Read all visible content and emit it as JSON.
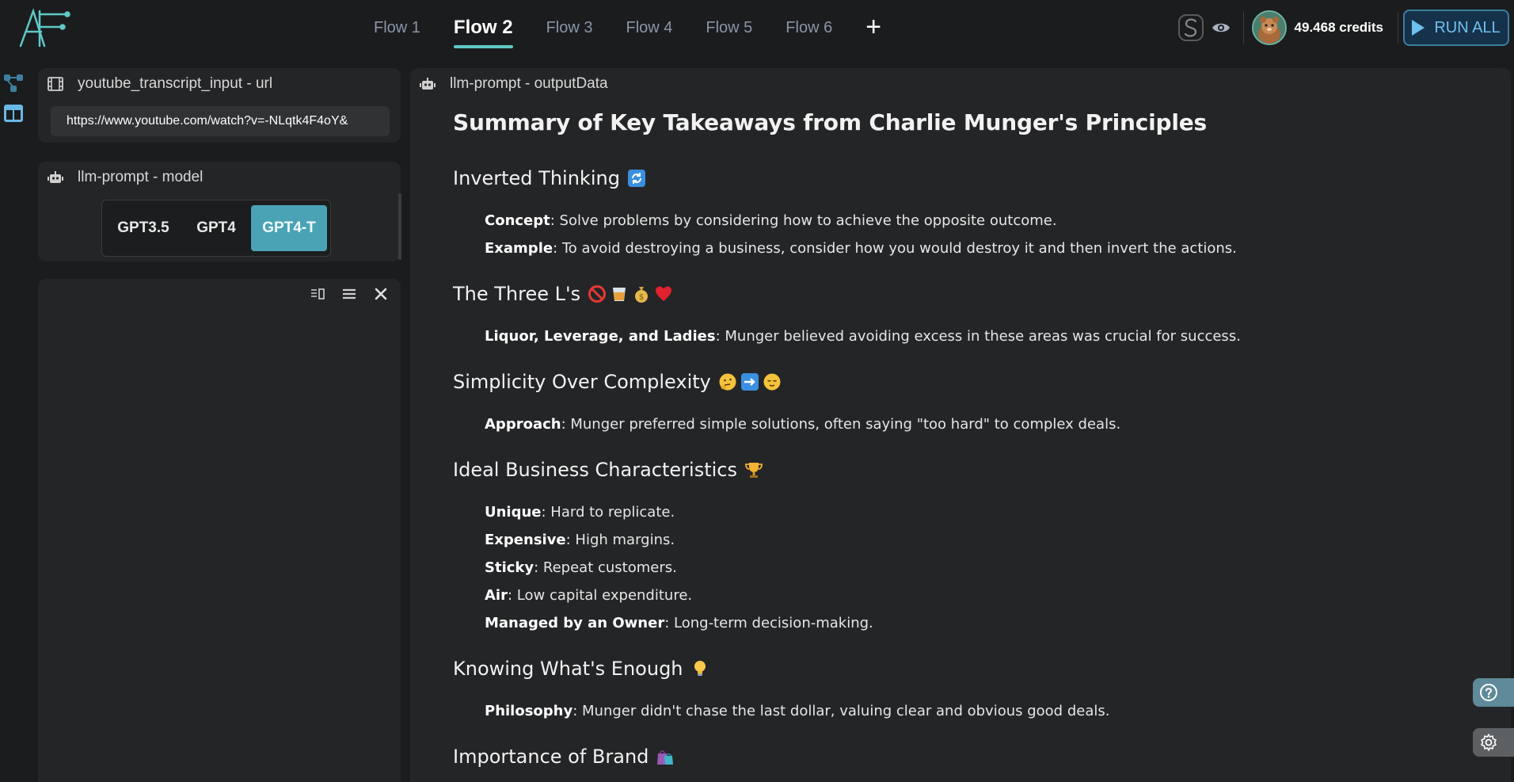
{
  "header": {
    "logo_text": "AF",
    "tabs": [
      {
        "label": "Flow 1",
        "active": false
      },
      {
        "label": "Flow 2",
        "active": true
      },
      {
        "label": "Flow 3",
        "active": false
      },
      {
        "label": "Flow 4",
        "active": false
      },
      {
        "label": "Flow 5",
        "active": false
      },
      {
        "label": "Flow 6",
        "active": false
      }
    ],
    "add_tab_label": "+",
    "s_badge": "S",
    "credits": "49.468 credits",
    "run_all_label": "RUN ALL"
  },
  "rail": {
    "icons": [
      "flow-graph-icon",
      "layout-panels-icon"
    ]
  },
  "url_panel": {
    "title": "youtube_transcript_input - url",
    "icon": "film-icon",
    "value": "https://www.youtube.com/watch?v=-NLqtk4F4oY&"
  },
  "model_panel": {
    "title": "llm-prompt - model",
    "icon": "robot-icon",
    "options": [
      {
        "label": "GPT3.5",
        "selected": false
      },
      {
        "label": "GPT4",
        "selected": false
      },
      {
        "label": "GPT4-T",
        "selected": true
      }
    ]
  },
  "empty_panel": {
    "tools": [
      "split-view-icon",
      "menu-icon",
      "close-icon"
    ]
  },
  "output_panel": {
    "title": "llm-prompt - outputData",
    "icon": "robot-icon",
    "heading": "Summary of Key Takeaways from Charlie Munger's Principles",
    "sections": [
      {
        "title": "Inverted Thinking",
        "emojis": [
          "🔄"
        ],
        "items": [
          {
            "label": "Concept",
            "text": ": Solve problems by considering how to achieve the opposite outcome."
          },
          {
            "label": "Example",
            "text": ": To avoid destroying a business, consider how you would destroy it and then invert the actions."
          }
        ]
      },
      {
        "title": "The Three L's",
        "emojis": [
          "🚫",
          "🥃",
          "💰",
          "❤️"
        ],
        "items": [
          {
            "label": "Liquor, Leverage, and Ladies",
            "text": ": Munger believed avoiding excess in these areas was crucial for success."
          }
        ]
      },
      {
        "title": "Simplicity Over Complexity",
        "emojis": [
          "🤔",
          "➡️",
          "😌"
        ],
        "items": [
          {
            "label": "Approach",
            "text": ": Munger preferred simple solutions, often saying \"too hard\" to complex deals."
          }
        ]
      },
      {
        "title": "Ideal Business Characteristics",
        "emojis": [
          "🏆"
        ],
        "items": [
          {
            "label": "Unique",
            "text": ": Hard to replicate."
          },
          {
            "label": "Expensive",
            "text": ": High margins."
          },
          {
            "label": "Sticky",
            "text": ": Repeat customers."
          },
          {
            "label": "Air",
            "text": ": Low capital expenditure."
          },
          {
            "label": "Managed by an Owner",
            "text": ": Long-term decision-making."
          }
        ]
      },
      {
        "title": "Knowing What's Enough",
        "emojis": [
          "💡"
        ],
        "items": [
          {
            "label": "Philosophy",
            "text": ": Munger didn't chase the last dollar, valuing clear and obvious good deals."
          }
        ]
      },
      {
        "title": "Importance of Brand",
        "emojis": [
          "🛍️"
        ],
        "items": []
      }
    ]
  },
  "floating": {
    "help_icon": "help-circle-icon",
    "settings_icon": "settings-gear-icon"
  },
  "colors": {
    "accent": "#5fc9c6",
    "selected_model": "#4aa3b5",
    "run_all_text": "#6ec0ef",
    "background": "#1b1c1e",
    "panel": "#242527"
  }
}
